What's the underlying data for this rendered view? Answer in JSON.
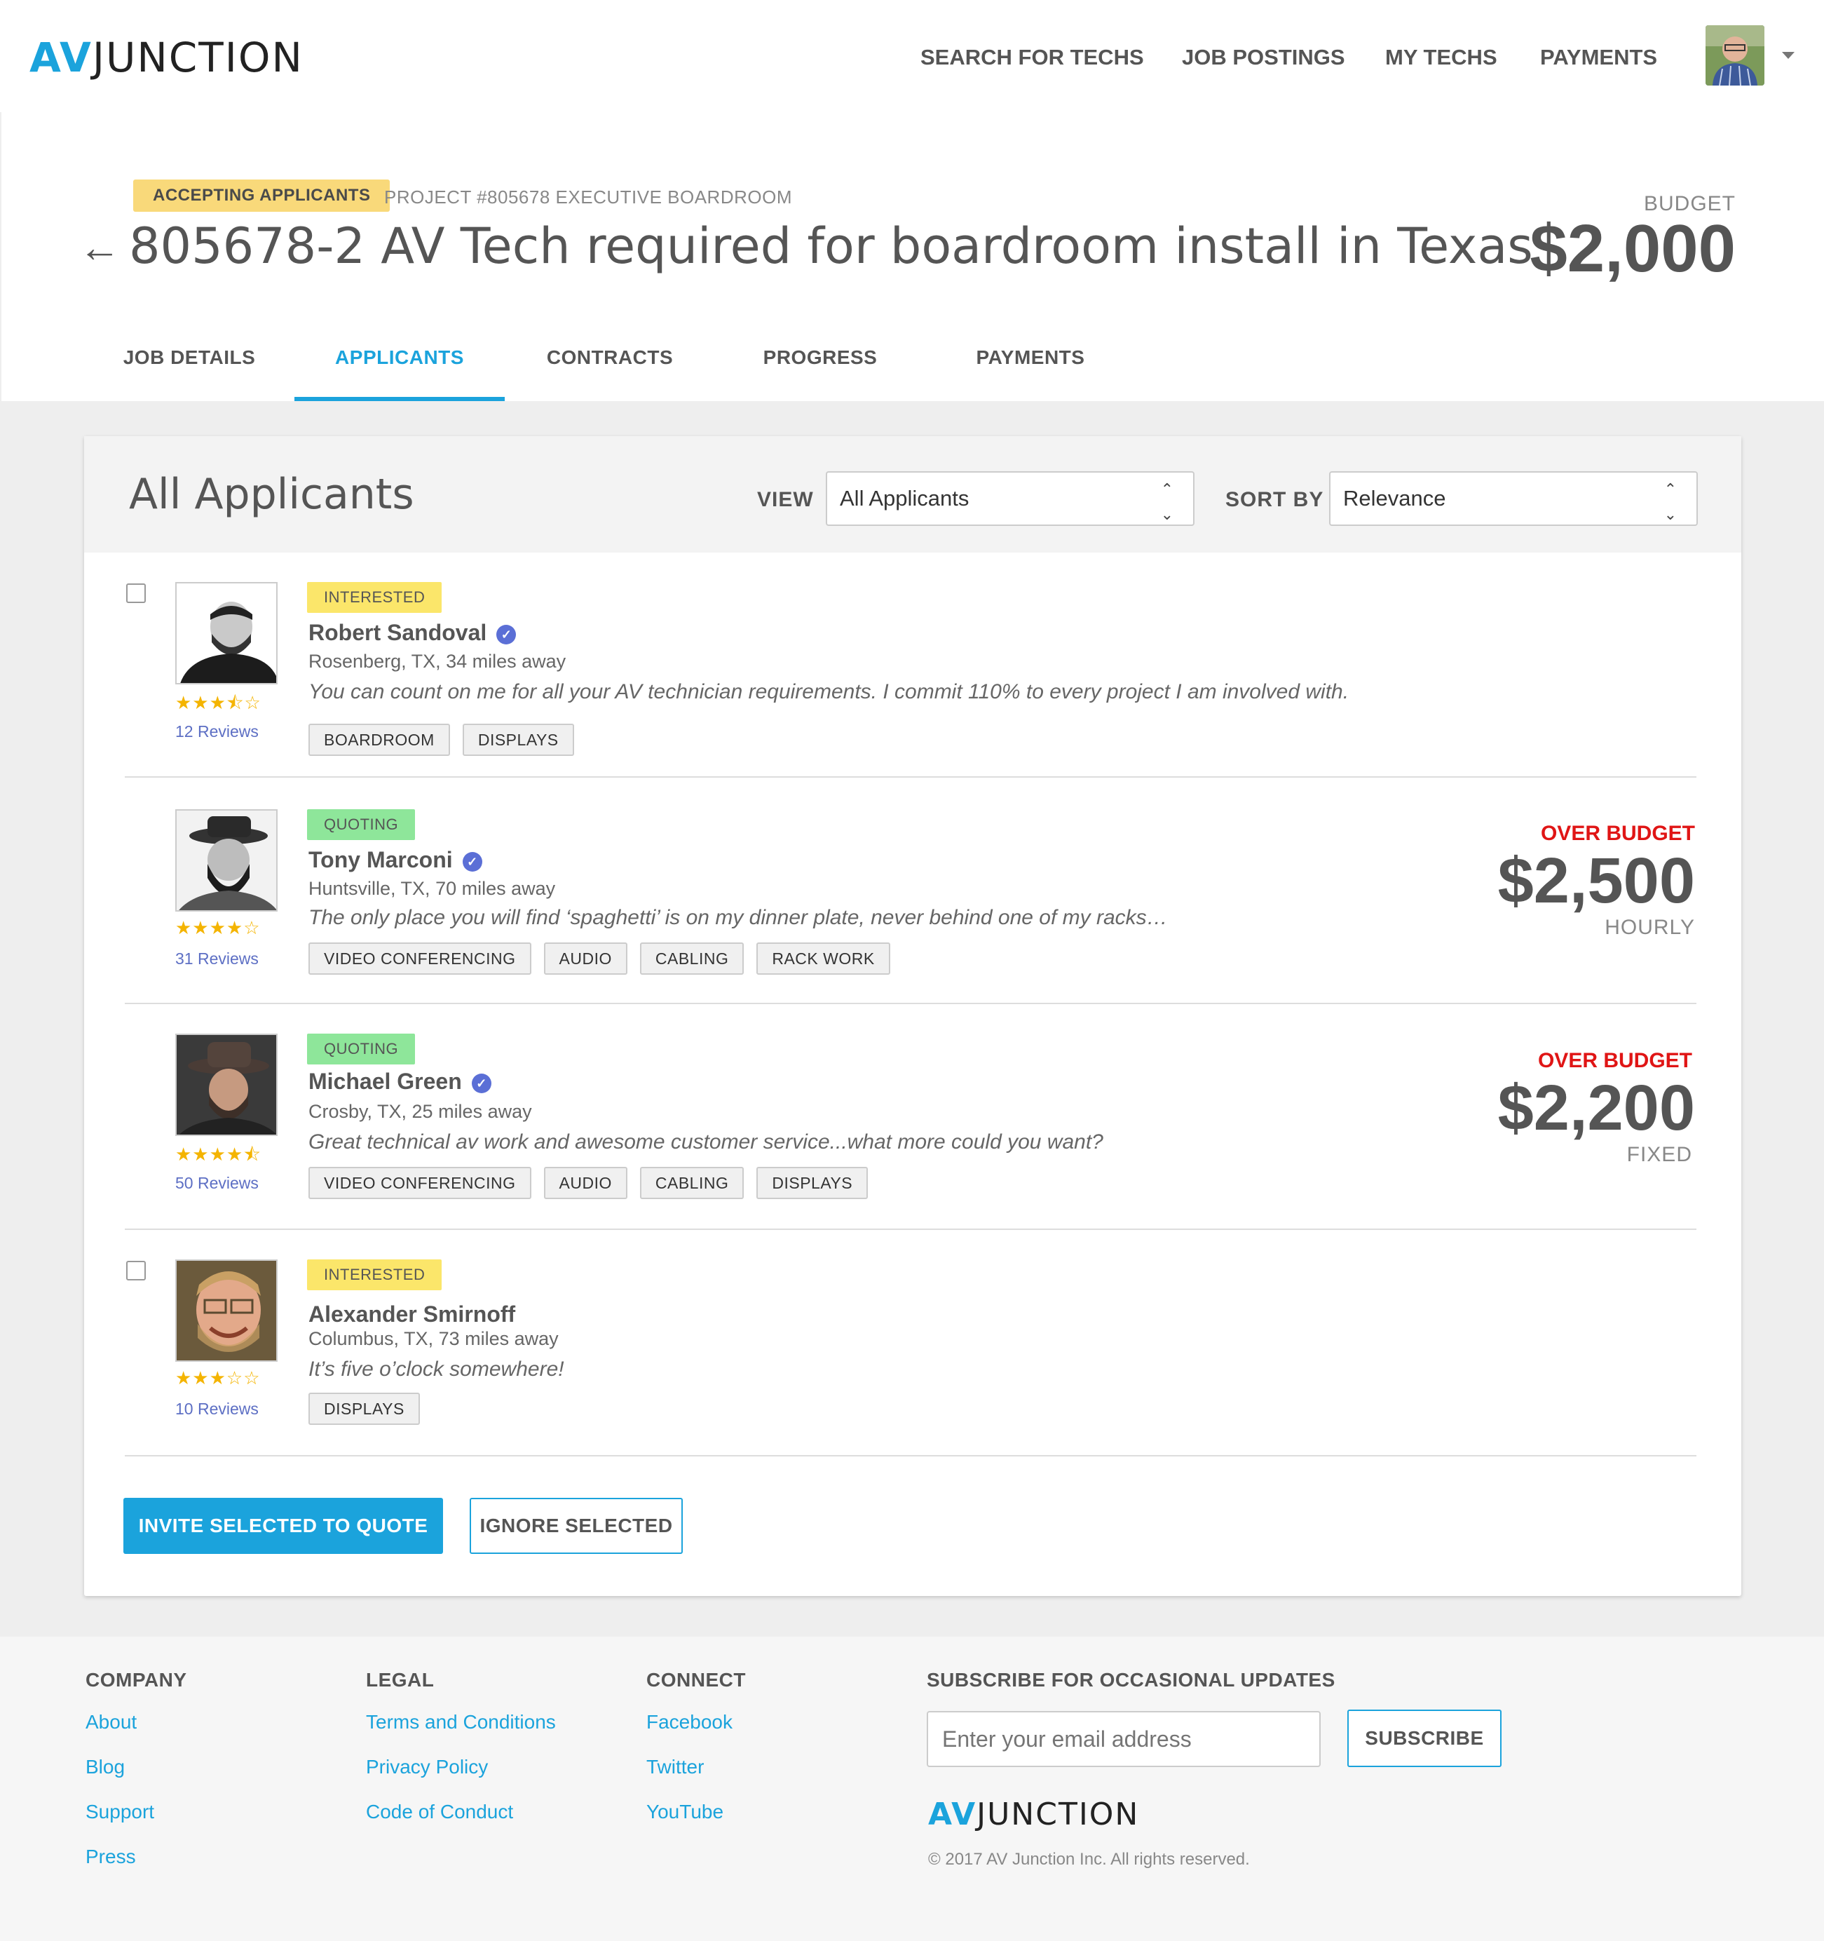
{
  "header": {
    "logo_av": "AV",
    "logo_junction": "JUNCTION",
    "nav": [
      "SEARCH FOR TECHS",
      "JOB POSTINGS",
      "MY TECHS",
      "PAYMENTS"
    ]
  },
  "job": {
    "status_badge": "ACCEPTING APPLICANTS",
    "project_label": "PROJECT #805678 EXECUTIVE BOARDROOM",
    "back_icon": "←",
    "title": "805678-2 AV Tech required for boardroom install in Texas",
    "budget_label": "BUDGET",
    "budget_value": "$2,000"
  },
  "tabs": [
    {
      "label": "JOB DETAILS",
      "active": false
    },
    {
      "label": "APPLICANTS",
      "active": true
    },
    {
      "label": "CONTRACTS",
      "active": false
    },
    {
      "label": "PROGRESS",
      "active": false
    },
    {
      "label": "PAYMENTS",
      "active": false
    }
  ],
  "applicants_panel": {
    "title": "All Applicants",
    "view_label": "VIEW",
    "view_value": "All Applicants",
    "sort_label": "SORT BY",
    "sort_value": "Relevance"
  },
  "applicants": [
    {
      "status": "INTERESTED",
      "name": "Robert Sandoval",
      "verified": true,
      "location": "Rosenberg, TX, 34 miles away",
      "quote": "You can count on me for all your AV technician requirements.  I commit 110% to every project I am involved with.",
      "stars": "★★★⯪☆",
      "rating": 3.5,
      "reviews": "12 Reviews",
      "tags": [
        "BOARDROOM",
        "DISPLAYS"
      ],
      "checkbox": true,
      "over_budget": "",
      "price": "",
      "rate": ""
    },
    {
      "status": "QUOTING",
      "name": "Tony Marconi",
      "verified": true,
      "location": "Huntsville, TX, 70 miles away",
      "quote": "The only place you will find ‘spaghetti’ is on my dinner plate, never behind one of my racks…",
      "stars": "★★★★☆",
      "rating": 4,
      "reviews": "31 Reviews",
      "tags": [
        "VIDEO CONFERENCING",
        "AUDIO",
        "CABLING",
        "RACK WORK"
      ],
      "checkbox": false,
      "over_budget": "OVER BUDGET",
      "price": "$2,500",
      "rate": "HOURLY"
    },
    {
      "status": "QUOTING",
      "name": "Michael Green",
      "verified": true,
      "location": "Crosby, TX, 25 miles away",
      "quote": "Great technical av work and awesome customer service...what more could you want?",
      "stars": "★★★★⯪",
      "rating": 4.5,
      "reviews": "50 Reviews",
      "tags": [
        "VIDEO CONFERENCING",
        "AUDIO",
        "CABLING",
        "DISPLAYS"
      ],
      "checkbox": false,
      "over_budget": "OVER BUDGET",
      "price": "$2,200",
      "rate": "FIXED"
    },
    {
      "status": "INTERESTED",
      "name": "Alexander Smirnoff",
      "verified": false,
      "location": "Columbus, TX, 73 miles away",
      "quote": "It’s five o’clock somewhere!",
      "stars": "★★★☆☆",
      "rating": 3,
      "reviews": "10 Reviews",
      "tags": [
        "DISPLAYS"
      ],
      "checkbox": true,
      "over_budget": "",
      "price": "",
      "rate": ""
    }
  ],
  "actions": {
    "invite": "INVITE SELECTED TO QUOTE",
    "ignore": "IGNORE SELECTED"
  },
  "footer": {
    "company_title": "COMPANY",
    "company_links": [
      "About",
      "Blog",
      "Support",
      "Press"
    ],
    "legal_title": "LEGAL",
    "legal_links": [
      "Terms and Conditions",
      "Privacy Policy",
      "Code of Conduct"
    ],
    "connect_title": "CONNECT",
    "connect_links": [
      "Facebook",
      "Twitter",
      "YouTube"
    ],
    "subscribe_title": "SUBSCRIBE FOR OCCASIONAL UPDATES",
    "email_placeholder": "Enter your email address",
    "subscribe_button": "SUBSCRIBE",
    "logo_av": "AV",
    "logo_junction": "JUNCTION",
    "copyright": "© 2017 AV Junction Inc. All rights reserved."
  },
  "colors": {
    "accent": "#1ba3dc",
    "over_budget": "#e01515",
    "interested": "#fbe66a",
    "quoting": "#8ee69a",
    "accepting": "#f9d97a",
    "stars": "#f4b400"
  }
}
